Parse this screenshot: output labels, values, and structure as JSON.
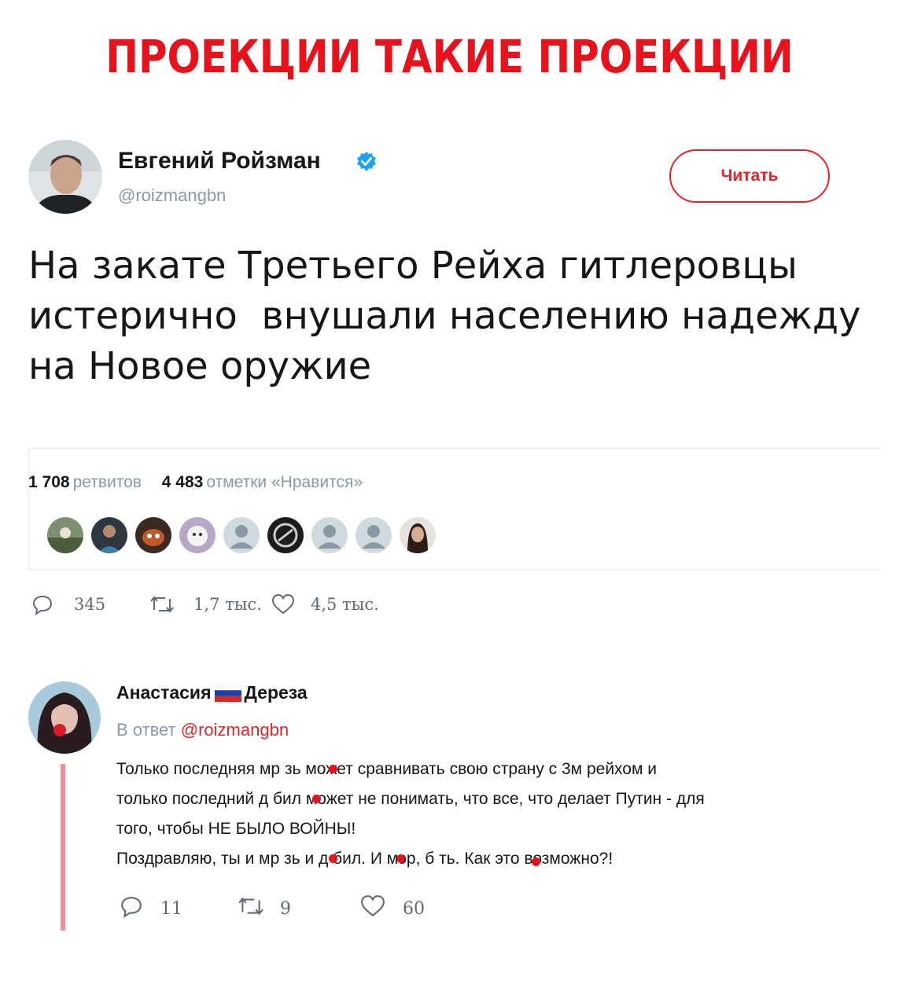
{
  "headline": "ПРОЕКЦИИ ТАКИЕ ПРОЕКЦИИ",
  "tweet": {
    "author_name": "Евгений Ройзман",
    "author_handle": "@roizmangbn",
    "follow_label": "Читать",
    "text_lines": [
      "На закате Третьего Рейха гитлеровцы",
      "истерично  внушали населению надежду",
      "на Новое оружие"
    ],
    "retweets_count": "1 708",
    "retweets_label": "ретвитов",
    "likes_count": "4 483",
    "likes_label": "отметки «Нравится»",
    "replies_action": "345",
    "retweets_action": "1,7 тыс.",
    "likes_action": "4,5 тыс.",
    "accent_color": "#e0242a",
    "verified_color": "#1da1f2"
  },
  "reply": {
    "author_first": "Анастасия",
    "author_last": "Дереза",
    "reply_prefix": "В ответ",
    "reply_mention": "@roizmangbn",
    "text_lines": [
      "Только последняя мр зь может сравнивать свою страну с 3м рейхом и",
      "только последний д бил может не понимать, что все, что делает Путин - для",
      "того, чтобы НЕ БЫЛО ВОЙНЫ!",
      "Поздравляю, ты и мр зь и д бил. И мэр, б ть. Как это возможно?!"
    ],
    "replies_count": "11",
    "retweets_count": "9",
    "likes_count": "60",
    "thread_color": "#f08f93"
  }
}
